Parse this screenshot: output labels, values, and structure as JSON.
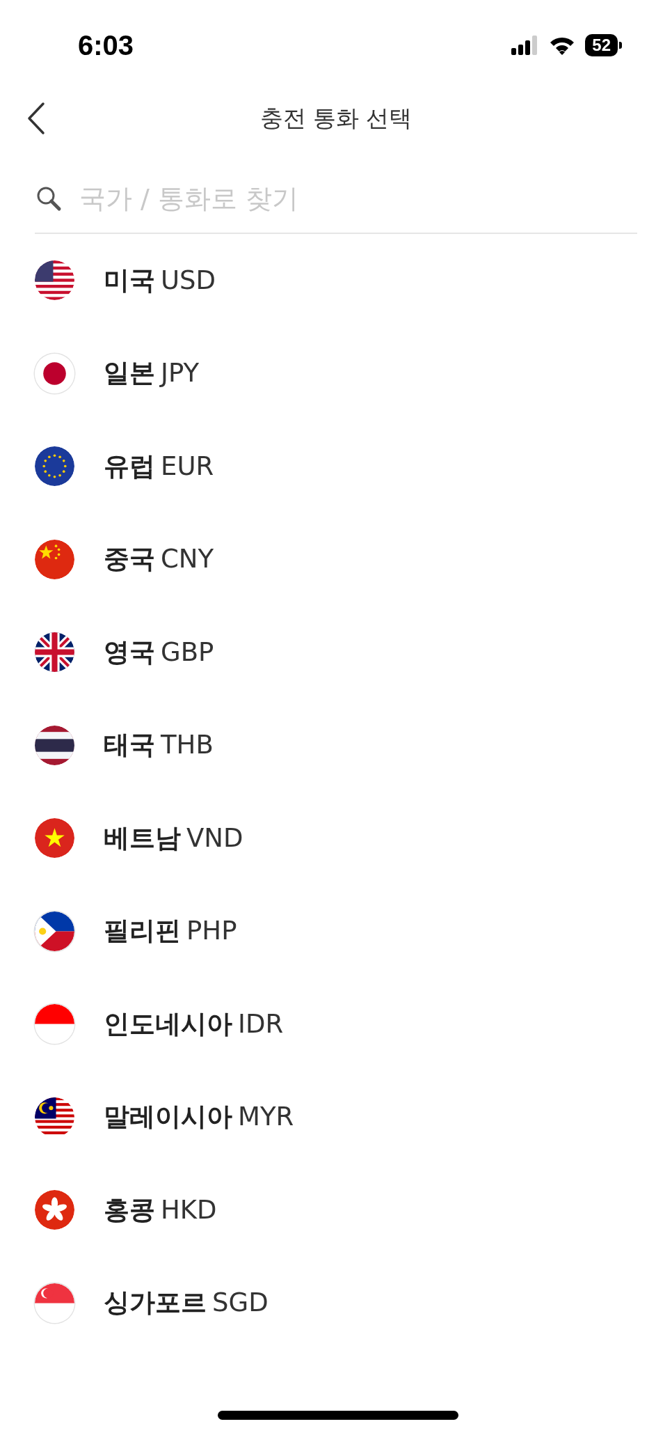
{
  "status_bar": {
    "time": "6:03",
    "battery": "52"
  },
  "nav": {
    "title": "충전 통화 선택"
  },
  "search": {
    "placeholder": "국가 / 통화로 찾기"
  },
  "currencies": [
    {
      "country": "미국",
      "code": "USD",
      "kind": "us"
    },
    {
      "country": "일본",
      "code": "JPY",
      "kind": "jp"
    },
    {
      "country": "유럽",
      "code": "EUR",
      "kind": "eu"
    },
    {
      "country": "중국",
      "code": "CNY",
      "kind": "cn"
    },
    {
      "country": "영국",
      "code": "GBP",
      "kind": "gb"
    },
    {
      "country": "태국",
      "code": "THB",
      "kind": "th"
    },
    {
      "country": "베트남",
      "code": "VND",
      "kind": "vn"
    },
    {
      "country": "필리핀",
      "code": "PHP",
      "kind": "ph"
    },
    {
      "country": "인도네시아",
      "code": "IDR",
      "kind": "id"
    },
    {
      "country": "말레이시아",
      "code": "MYR",
      "kind": "my"
    },
    {
      "country": "홍콩",
      "code": "HKD",
      "kind": "hk"
    },
    {
      "country": "싱가포르",
      "code": "SGD",
      "kind": "sg"
    }
  ]
}
